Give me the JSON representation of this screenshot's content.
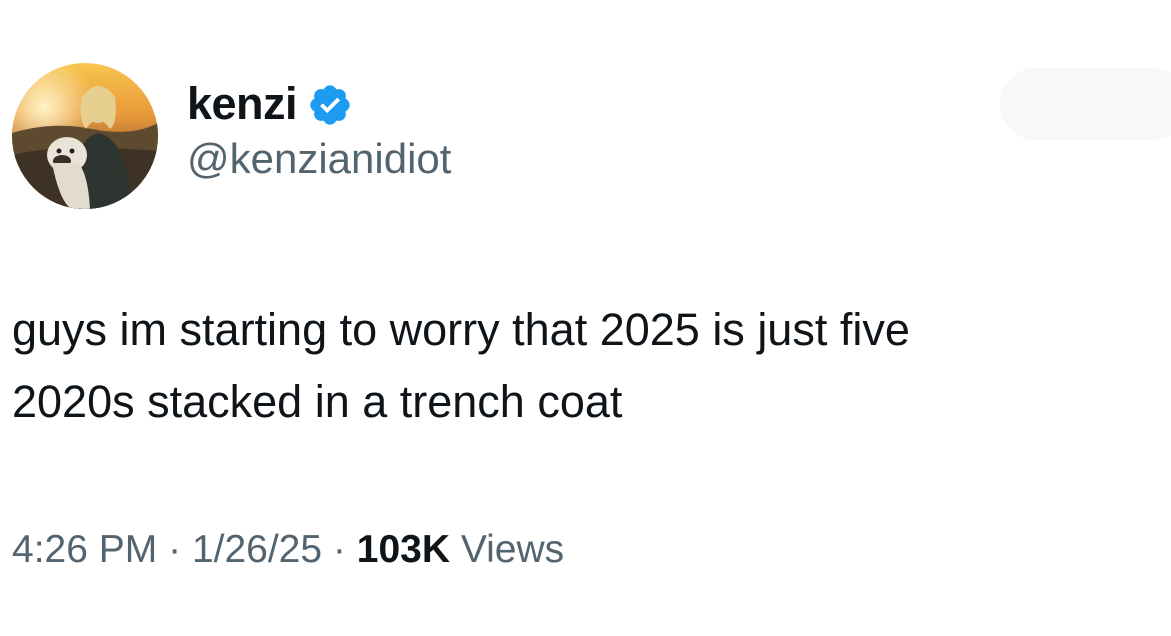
{
  "author": {
    "display_name": "kenzi",
    "handle": "@kenzianidiot",
    "verified": true,
    "verified_color": "#1d9bf0"
  },
  "tweet": {
    "text_line_1": "guys im starting to worry that 2025 is just five",
    "text_line_2": "2020s stacked in a trench coat"
  },
  "meta": {
    "time": "4:26 PM",
    "separator": "·",
    "date": "1/26/25",
    "views_count": "103K",
    "views_label": "Views"
  },
  "colors": {
    "primary_text": "#0f1419",
    "secondary_text": "#536471"
  },
  "icons": {
    "verified": "verified-badge-icon",
    "avatar": "profile-photo"
  }
}
